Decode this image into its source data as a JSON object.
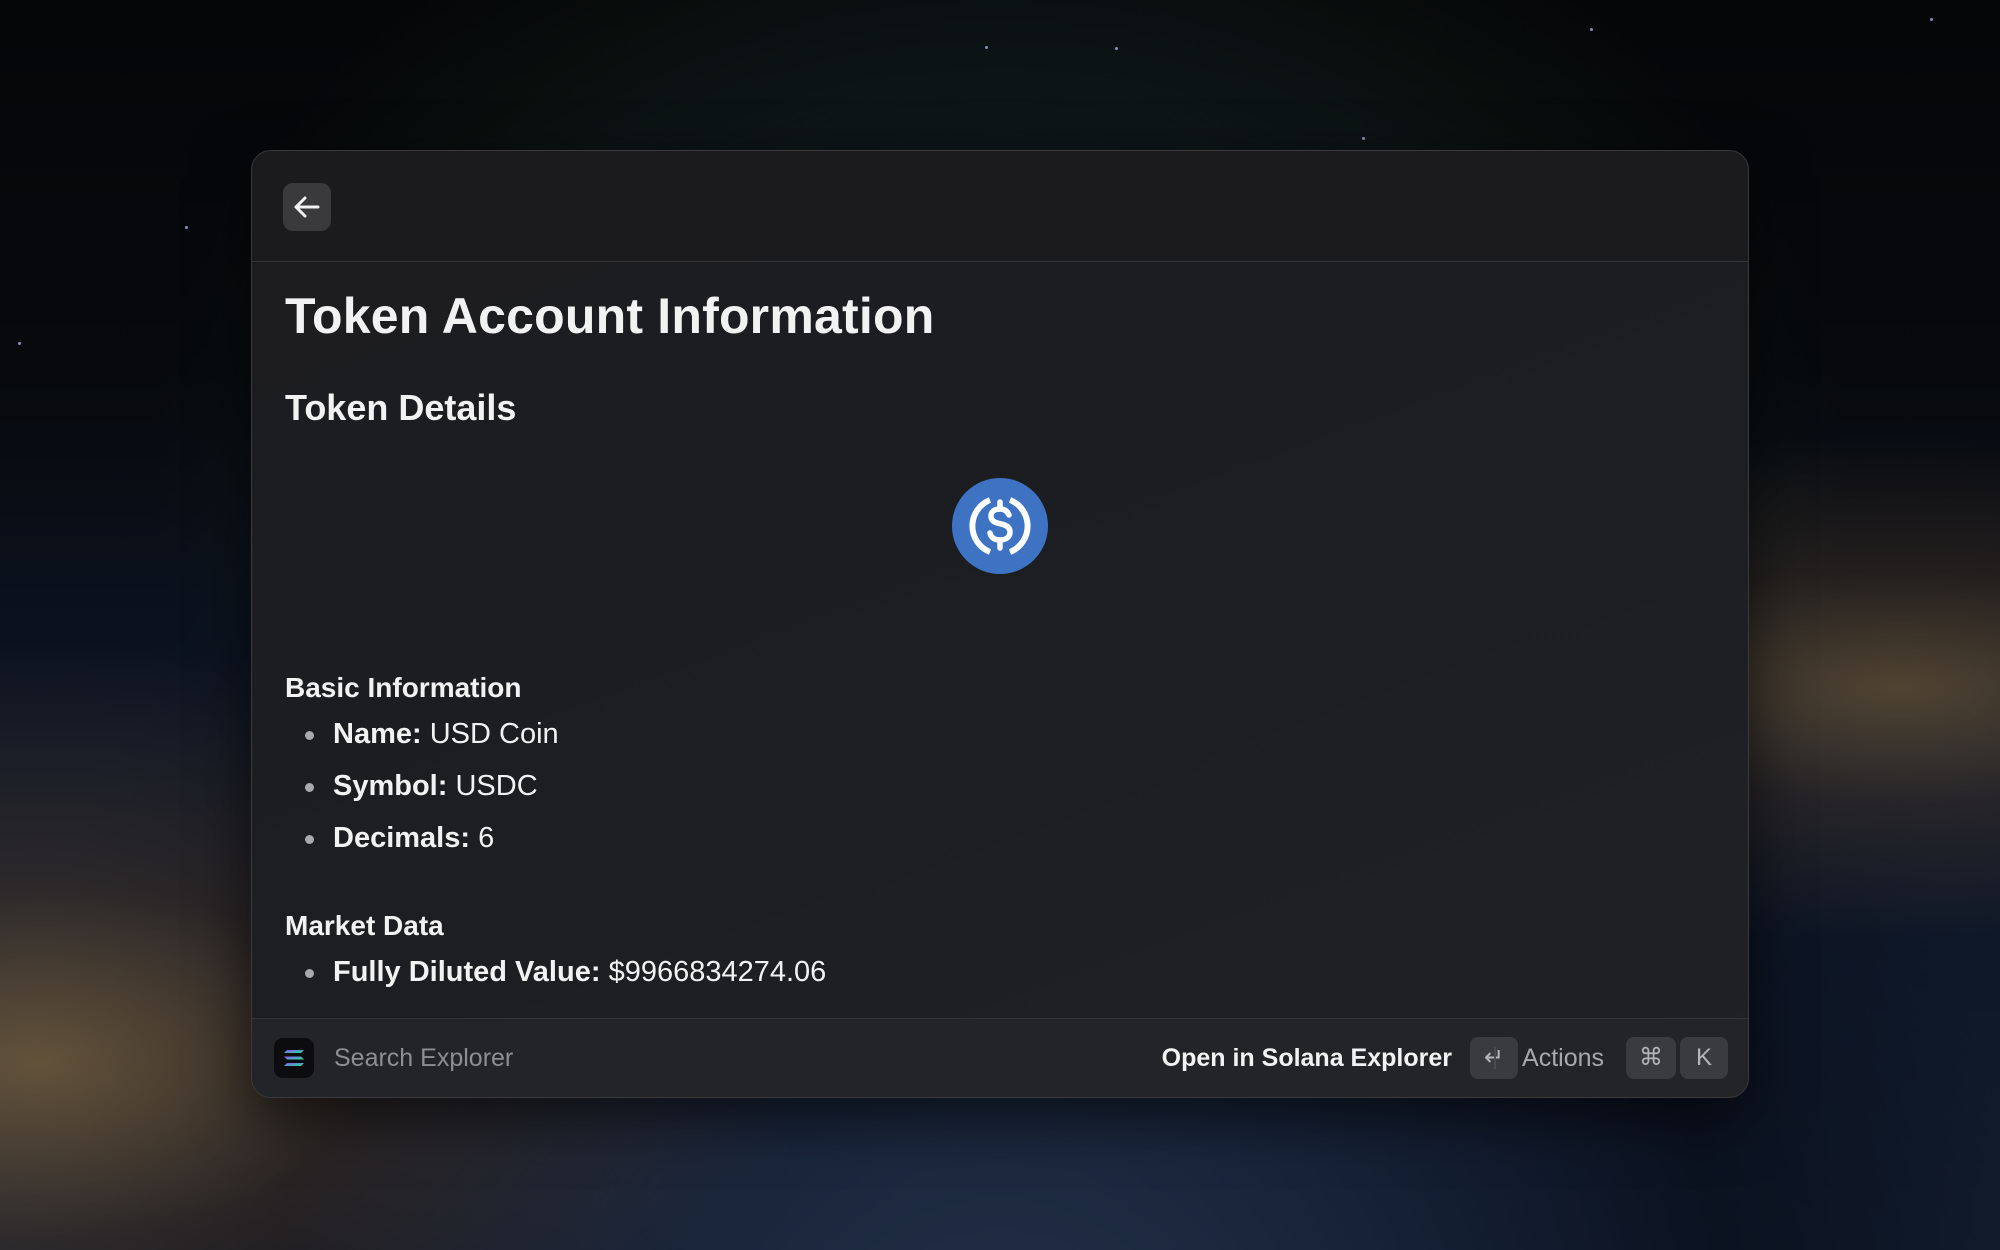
{
  "window": {
    "back_button_label": "",
    "title": "Token Account Information",
    "section_title": "Token Details",
    "token_logo_icon": "usdc-coin-icon",
    "accent_color": "#3e73c4"
  },
  "basic_info": {
    "heading": "Basic Information",
    "items": [
      {
        "key": "Name:",
        "value": "USD Coin"
      },
      {
        "key": "Symbol:",
        "value": "USDC"
      },
      {
        "key": "Decimals:",
        "value": "6"
      }
    ]
  },
  "market_data": {
    "heading": "Market Data",
    "items": [
      {
        "key": "Fully Diluted Value:",
        "value": "$9966834274.06"
      }
    ]
  },
  "bottombar": {
    "app_icon": "solana-icon",
    "search_placeholder": "Search Explorer",
    "primary_action_label": "Open in Solana Explorer",
    "enter_key": "↵",
    "actions_label": "Actions",
    "cmd_key": "⌘",
    "k_key": "K"
  }
}
